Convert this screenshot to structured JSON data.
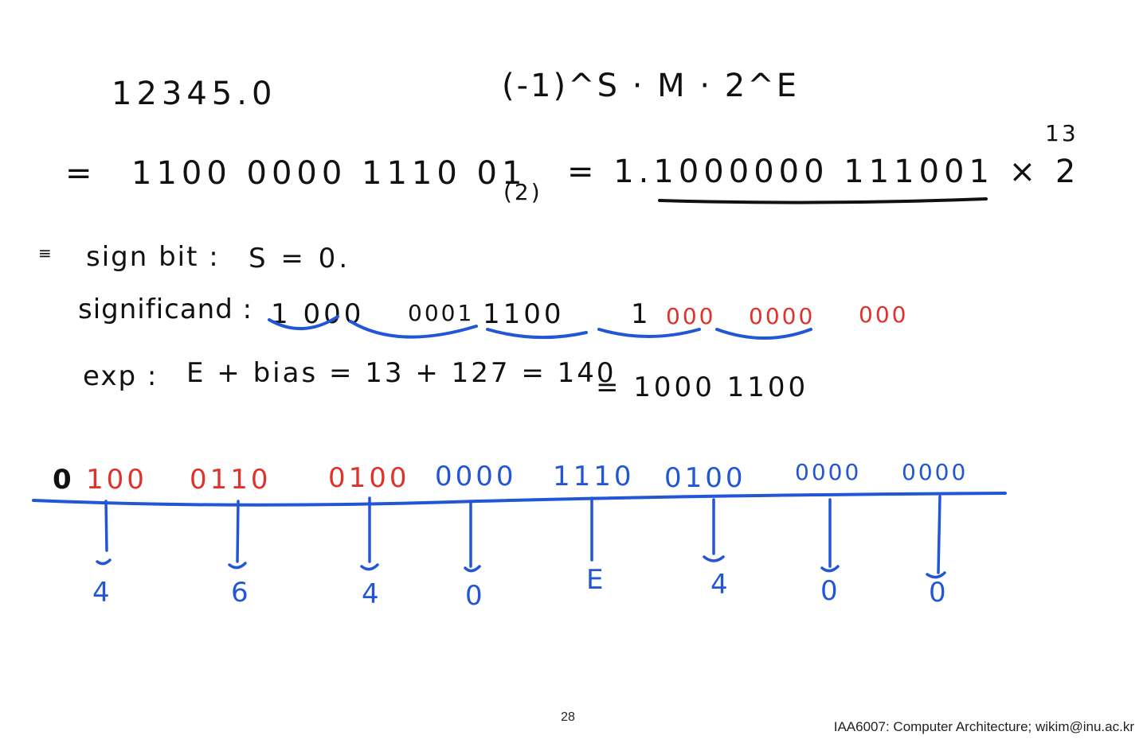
{
  "slide": {
    "decimal_value": "12345.0",
    "formula": "(-1)^S · M · 2^E",
    "binary_line": {
      "equals": "=",
      "binary": "1100 0000 1110 01",
      "subscript": "(2)",
      "normalized": "= 1.1000000 111001 × 2",
      "exponent": "13"
    },
    "sign_bit": {
      "label": "sign bit :",
      "value": "S = 0."
    },
    "significand": {
      "label": "significand :",
      "groups_black": [
        "1 000",
        "0001",
        "1100",
        "1"
      ],
      "groups_red": [
        "000",
        "0000",
        "000"
      ]
    },
    "exp": {
      "label": "exp :",
      "formula": "E + bias = 13 + 127 = 140",
      "binary": "= 1000 1100"
    },
    "bitfield": {
      "sign": "0",
      "groups": [
        "100",
        "0110",
        "0100",
        "0000",
        "1110",
        "0100",
        "0000",
        "0000"
      ]
    },
    "hex_digits": [
      "4",
      "6",
      "4",
      "0",
      "E",
      "4",
      "0",
      "0"
    ],
    "page_number": "28",
    "footer": "IAA6007: Computer Architecture; wikim@inu.ac.kr",
    "colors": {
      "ink": "#111111",
      "red": "#e0322c",
      "blue": "#2356d6"
    }
  }
}
